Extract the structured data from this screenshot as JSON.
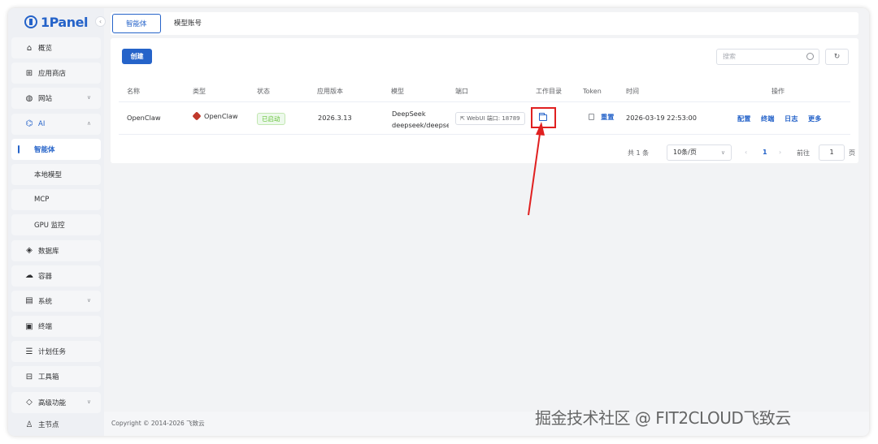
{
  "app": {
    "logo_text": "1Panel"
  },
  "sidebar": {
    "items": [
      {
        "label": "概览",
        "icon": "home-icon"
      },
      {
        "label": "应用商店",
        "icon": "grid-icon"
      },
      {
        "label": "网站",
        "icon": "globe-icon"
      },
      {
        "label": "AI",
        "icon": "robot-icon"
      },
      {
        "label": "智能体"
      },
      {
        "label": "本地模型"
      },
      {
        "label": "MCP"
      },
      {
        "label": "GPU 监控"
      },
      {
        "label": "数据库",
        "icon": "database-icon"
      },
      {
        "label": "容器",
        "icon": "container-icon"
      },
      {
        "label": "系统",
        "icon": "system-icon"
      },
      {
        "label": "终端",
        "icon": "terminal-icon"
      },
      {
        "label": "计划任务",
        "icon": "task-icon"
      },
      {
        "label": "工具箱",
        "icon": "toolbox-icon"
      },
      {
        "label": "高级功能",
        "icon": "advanced-icon"
      }
    ],
    "main_node": "主节点"
  },
  "tabs": [
    "智能体",
    "模型账号"
  ],
  "toolbar": {
    "create_label": "创建",
    "search_placeholder": "搜索"
  },
  "table": {
    "headers": [
      "名称",
      "类型",
      "状态",
      "应用版本",
      "模型",
      "端口",
      "工作目录",
      "Token",
      "时间",
      "操作"
    ],
    "rows": [
      {
        "name": "OpenClaw",
        "type": "OpenClaw",
        "status": "已启动",
        "version": "2026.3.13",
        "model_line1": "DeepSeek",
        "model_line2": "deepseek/deepse",
        "port": "WebUI 端口: 18789",
        "token_action": "重置",
        "time": "2026-03-19 22:53:00",
        "actions": [
          "配置",
          "终端",
          "日志",
          "更多"
        ]
      }
    ]
  },
  "pagination": {
    "total": "共 1 条",
    "page_size": "10条/页",
    "current_page": "1",
    "goto_label": "前往",
    "goto_value": "1",
    "page_suffix": "页"
  },
  "footer": {
    "copyright": "Copyright © 2014-2026 飞致云"
  },
  "watermark": "掘金技术社区 @ FIT2CLOUD飞致云",
  "colors": {
    "primary": "#2563c9",
    "highlight": "#e02020",
    "success": "#67c23a"
  }
}
